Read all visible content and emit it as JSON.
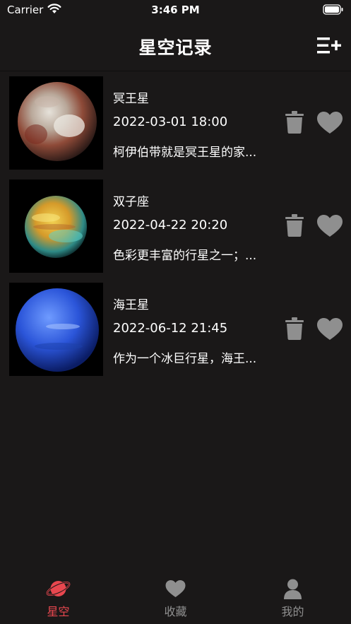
{
  "status_bar": {
    "carrier": "Carrier",
    "time": "3:46 PM"
  },
  "header": {
    "title": "星空记录",
    "add_icon": "list-add-icon"
  },
  "records": [
    {
      "title": "冥王星",
      "datetime": "2022-03-01 18:00",
      "description": "柯伊伯带就是冥王星的家...",
      "image": "pluto"
    },
    {
      "title": "双子座",
      "datetime": "2022-04-22 20:20",
      "description": "色彩更丰富的行星之一；...",
      "image": "gas-planet"
    },
    {
      "title": "海王星",
      "datetime": "2022-06-12 21:45",
      "description": "作为一个冰巨行星，海王...",
      "image": "neptune"
    }
  ],
  "tabs": [
    {
      "label": "星空",
      "icon": "planet-icon",
      "active": true
    },
    {
      "label": "收藏",
      "icon": "heart-icon",
      "active": false
    },
    {
      "label": "我的",
      "icon": "person-icon",
      "active": false
    }
  ],
  "colors": {
    "background": "#1a1818",
    "accent": "#e8474f",
    "icon_gray": "#8f8f8f"
  }
}
